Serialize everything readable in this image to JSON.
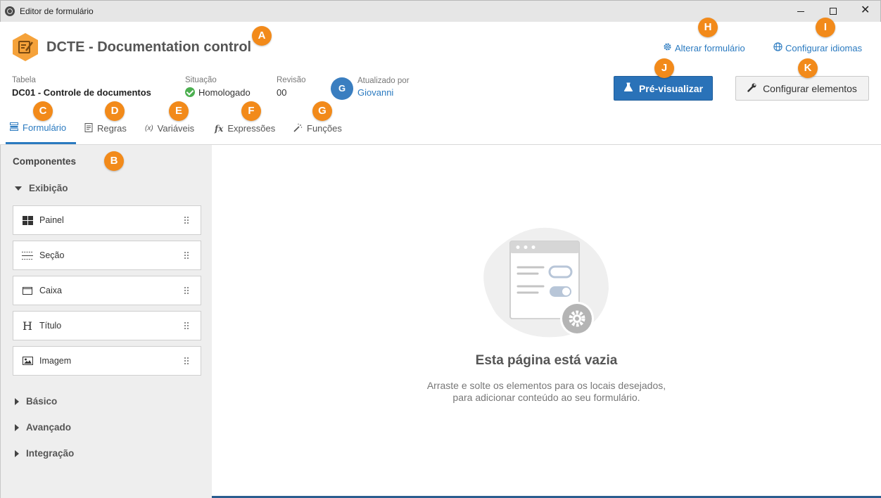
{
  "window": {
    "title": "Editor de formulário",
    "close_glyph": "✕"
  },
  "header": {
    "app_name": "DCTE - Documentation control",
    "links": {
      "alter_form": "Alterar formulário",
      "config_languages": "Configurar idiomas"
    },
    "meta": {
      "table_label": "Tabela",
      "table_value": "DC01 - Controle de documentos",
      "status_label": "Situação",
      "status_value": "Homologado",
      "revision_label": "Revisão",
      "revision_value": "00",
      "avatar_initial": "G",
      "updated_by_label": "Atualizado por",
      "updated_by_value": "Giovanni"
    },
    "buttons": {
      "preview": "Pré-visualizar",
      "configure_elements": "Configurar elementos"
    }
  },
  "tabs": [
    {
      "label": "Formulário",
      "icon": "form-icon",
      "active": true
    },
    {
      "label": "Regras",
      "icon": "rules-icon"
    },
    {
      "label": "Variáveis",
      "icon": "variables-icon",
      "glyph": "(x)"
    },
    {
      "label": "Expressões",
      "icon": "expressions-icon",
      "glyph": "fx"
    },
    {
      "label": "Funções",
      "icon": "functions-icon"
    }
  ],
  "sidebar": {
    "title": "Componentes",
    "sections": {
      "display": "Exibição",
      "basic": "Básico",
      "advanced": "Avançado",
      "integration": "Integração"
    },
    "components": [
      {
        "label": "Painel",
        "icon": "panel-icon"
      },
      {
        "label": "Seção",
        "icon": "section-icon"
      },
      {
        "label": "Caixa",
        "icon": "box-icon"
      },
      {
        "label": "Título",
        "icon": "title-icon",
        "glyph": "H"
      },
      {
        "label": "Imagem",
        "icon": "image-icon"
      }
    ]
  },
  "empty_state": {
    "title": "Esta página está vazia",
    "line1": "Arraste e solte os elementos para os locais desejados,",
    "line2": "para adicionar conteúdo ao seu formulário."
  },
  "badges": [
    "A",
    "B",
    "C",
    "D",
    "E",
    "F",
    "G",
    "H",
    "I",
    "J",
    "K"
  ],
  "colors": {
    "accent": "#2a7ac0",
    "primary_button": "#2a72b8",
    "badge": "#f28a1a",
    "logo": "#f5a23a",
    "status_ok": "#4caf50"
  }
}
